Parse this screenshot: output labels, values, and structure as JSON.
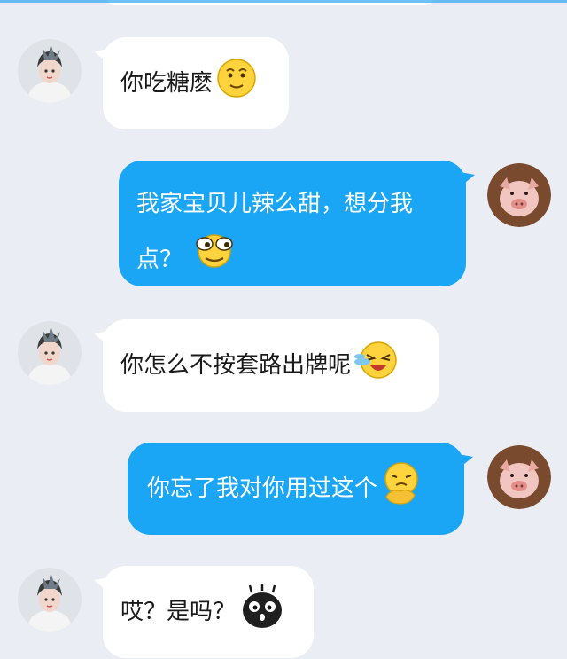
{
  "messages": [
    {
      "direction": "incoming",
      "text": "你吃糖麽",
      "emoji": "smile-emoji"
    },
    {
      "direction": "outgoing",
      "text_line1": "我家宝贝儿辣么甜，想分我",
      "text_line2": "点？",
      "emoji": "side-eye-emoji"
    },
    {
      "direction": "incoming",
      "text": "你怎么不按套路出牌呢",
      "emoji": "laugh-cry-emoji"
    },
    {
      "direction": "outgoing",
      "text": "你忘了我对你用过这个",
      "emoji": "shy-hand-emoji"
    },
    {
      "direction": "incoming",
      "text": "哎？是吗？",
      "emoji": "black-creature-emoji"
    }
  ],
  "colors": {
    "background": "#ebedf4",
    "incoming_bubble": "#ffffff",
    "outgoing_bubble": "#1aa6f5",
    "outgoing_text": "#ffffff",
    "incoming_text": "#1a1a1a"
  }
}
